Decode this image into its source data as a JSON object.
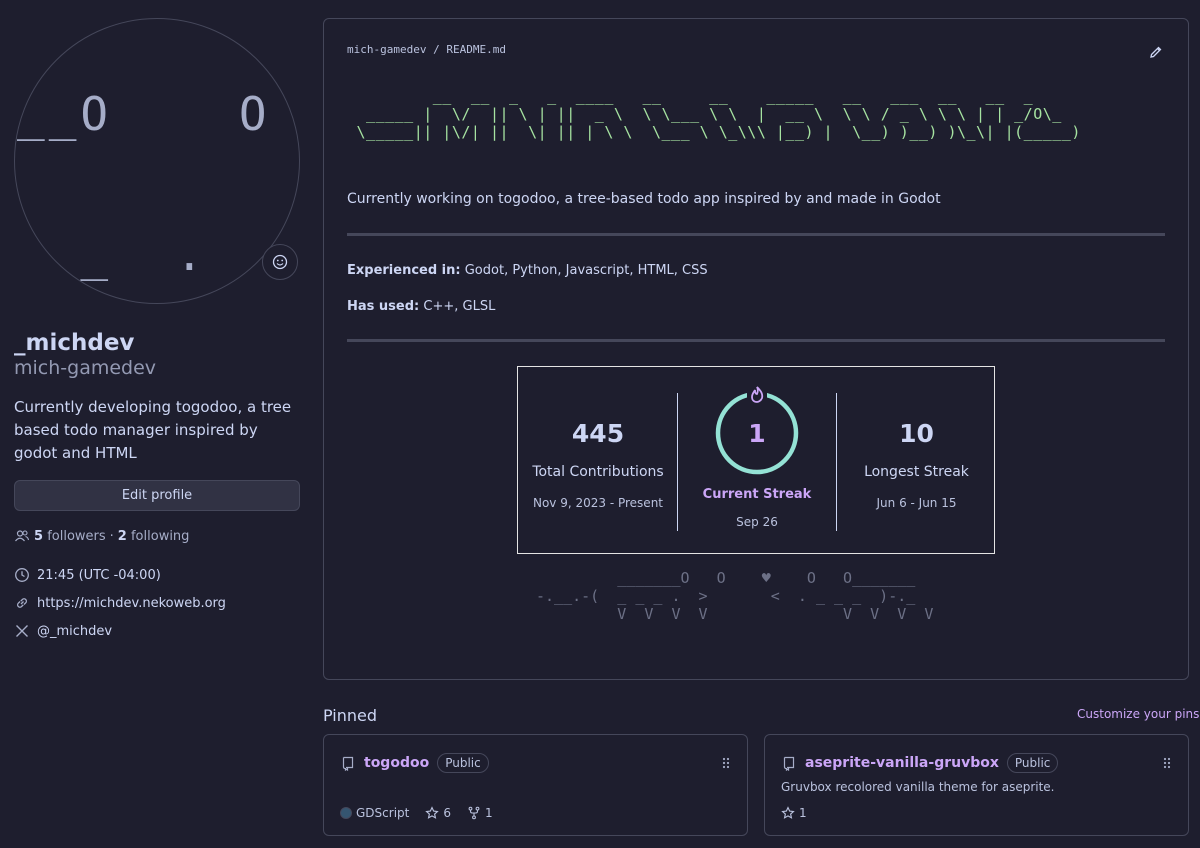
{
  "profile": {
    "avatar_art": "__O    O\n\n_ _  .  >\n\nV  V",
    "display_name": "_michdev",
    "username": "mich-gamedev",
    "bio": "Currently developing togodoo, a tree based todo manager inspired by godot and HTML",
    "edit_label": "Edit profile",
    "followers_count": "5",
    "followers_label": "followers",
    "following_count": "2",
    "following_label": "following",
    "separator": "·",
    "time": "21:45 (UTC -04:00)",
    "website": "https://michdev.nekoweb.org",
    "x_handle": "@_michdev"
  },
  "readme": {
    "owner": "mich-gamedev",
    "slash": "/",
    "file": "README.md",
    "ascii_banner": "         __  __  _   _  ____   __     __    _____   __   ___  __   __  _\n  _____ |  \\/  || \\ | ||  _ \\  \\ \\___ \\ \\  |  __ \\  \\ \\ / _ \\ \\ \\ | | _/O\\_\n \\_____|| |\\/| ||  \\| || | \\ \\  \\___ \\ \\_\\\\\\ |__) |  \\__) )__) )\\_\\| |(_____)\n",
    "tagline": "Currently working on togodoo, a tree-based todo app inspired by and made in Godot",
    "experienced_label": "Experienced in:",
    "experienced_value": "Godot, Python, Javascript, HTML, CSS",
    "used_label": "Has used:",
    "used_value": "C++, GLSL",
    "ascii_cats": "         _______O   O    ♥    O   O_______\n-.__.-(  _ _ _ .  >       <  . _ _ _  )-._\n         V  V  V  V               V  V  V  V"
  },
  "streak": {
    "total": "445",
    "total_label": "Total Contributions",
    "total_range": "Nov 9, 2023 - Present",
    "current": "1",
    "current_label": "Current Streak",
    "current_date": "Sep 26",
    "longest": "10",
    "longest_label": "Longest Streak",
    "longest_range": "Jun 6 - Jun 15"
  },
  "pinned": {
    "title": "Pinned",
    "customize": "Customize your pins",
    "repos": [
      {
        "name": "togodoo",
        "visibility": "Public",
        "description": "",
        "language": "GDScript",
        "stars": "6",
        "forks": "1"
      },
      {
        "name": "aseprite-vanilla-gruvbox",
        "visibility": "Public",
        "description": "Gruvbox recolored vanilla theme for aseprite.",
        "stars": "1"
      }
    ]
  },
  "colors": {
    "background": "#1e1e2e",
    "accent": "#cba6f7",
    "banner": "#a6e3a1",
    "ring": "#94e2d5"
  }
}
